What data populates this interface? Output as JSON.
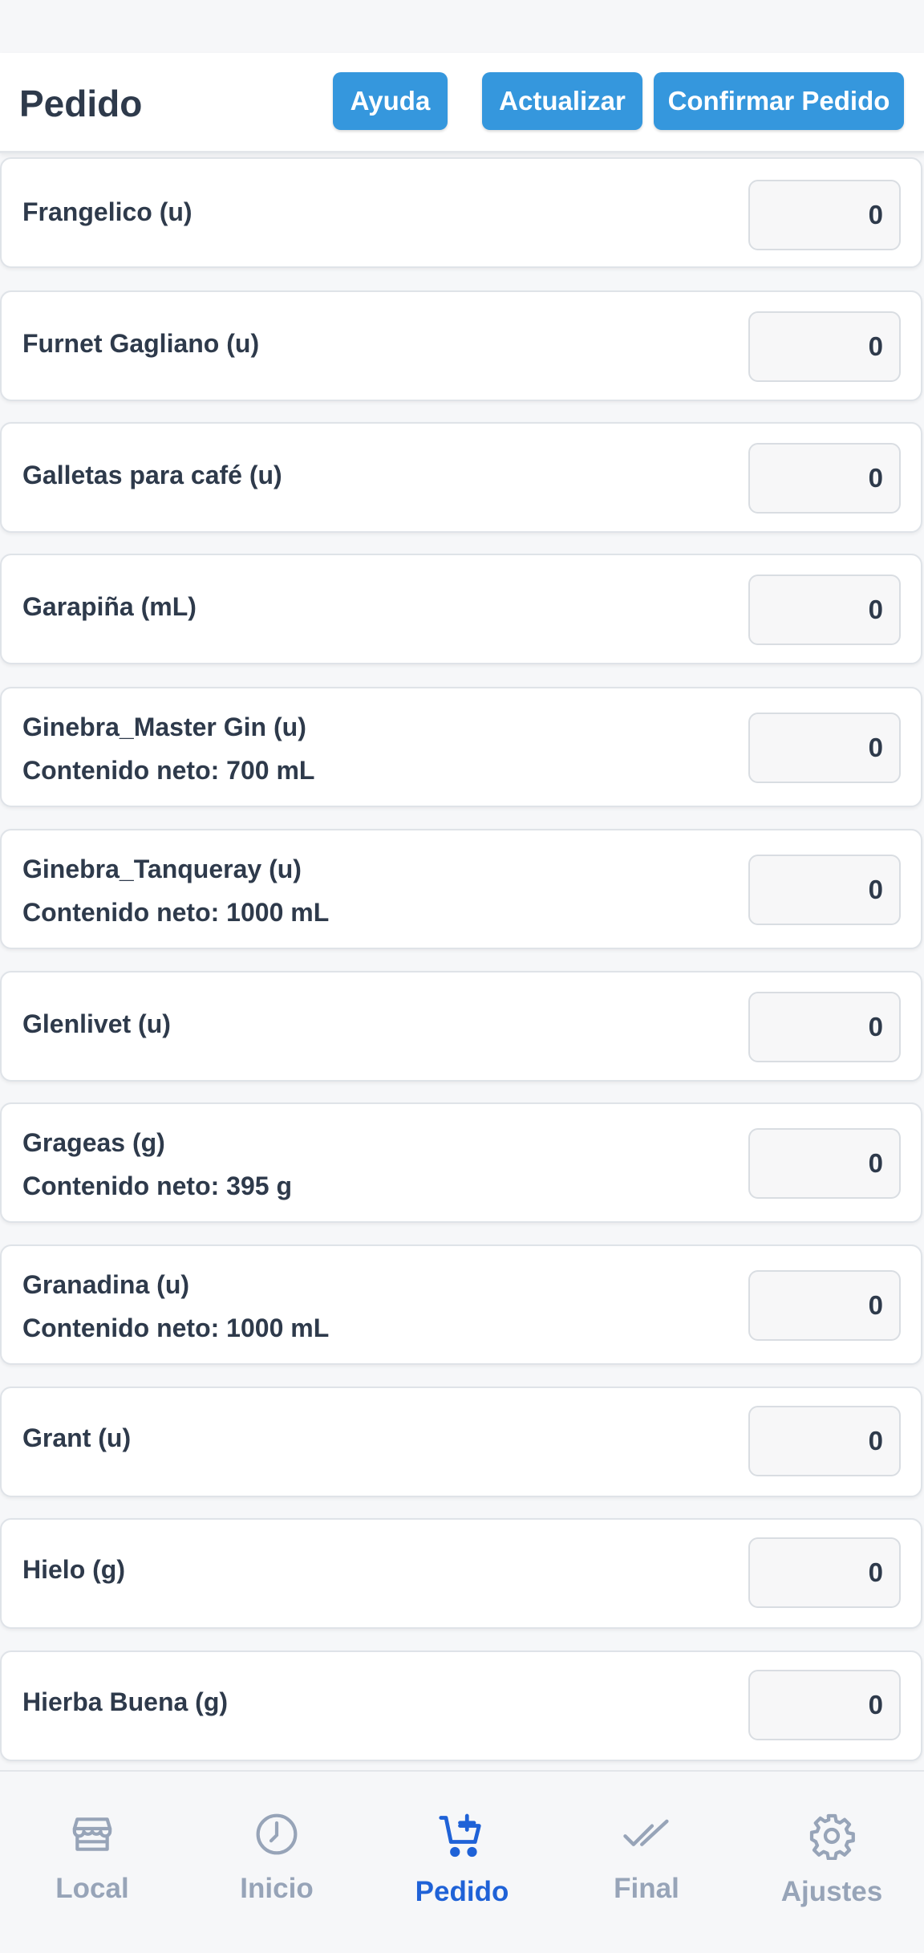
{
  "header": {
    "title": "Pedido",
    "help_label": "Ayuda",
    "refresh_label": "Actualizar",
    "confirm_label": "Confirmar Pedido"
  },
  "items": [
    {
      "name": "Frangelico (u)",
      "net": "",
      "qty": "0"
    },
    {
      "name": "Furnet Gagliano (u)",
      "net": "",
      "qty": "0"
    },
    {
      "name": "Galletas para café (u)",
      "net": "",
      "qty": "0"
    },
    {
      "name": "Garapiña (mL)",
      "net": "",
      "qty": "0"
    },
    {
      "name": "Ginebra_Master Gin (u)",
      "net": "Contenido neto: 700 mL",
      "qty": "0"
    },
    {
      "name": "Ginebra_Tanqueray (u)",
      "net": "Contenido neto: 1000 mL",
      "qty": "0"
    },
    {
      "name": "Glenlivet (u)",
      "net": "",
      "qty": "0"
    },
    {
      "name": "Grageas (g)",
      "net": "Contenido neto: 395 g",
      "qty": "0"
    },
    {
      "name": "Granadina (u)",
      "net": "Contenido neto: 1000 mL",
      "qty": "0"
    },
    {
      "name": "Grant (u)",
      "net": "",
      "qty": "0"
    },
    {
      "name": "Hielo (g)",
      "net": "",
      "qty": "0"
    },
    {
      "name": "Hierba Buena (g)",
      "net": "",
      "qty": "0"
    }
  ],
  "nav": [
    {
      "label": "Local",
      "icon": "store-icon",
      "active": false
    },
    {
      "label": "Inicio",
      "icon": "clock-icon",
      "active": false
    },
    {
      "label": "Pedido",
      "icon": "cart-plus-icon",
      "active": true
    },
    {
      "label": "Final",
      "icon": "double-check-icon",
      "active": false
    },
    {
      "label": "Ajustes",
      "icon": "gear-icon",
      "active": false
    }
  ],
  "colors": {
    "primary_button": "#3597dd",
    "nav_active": "#1f62d7",
    "nav_inactive": "#97a4b8",
    "text": "#2e3a4b"
  }
}
